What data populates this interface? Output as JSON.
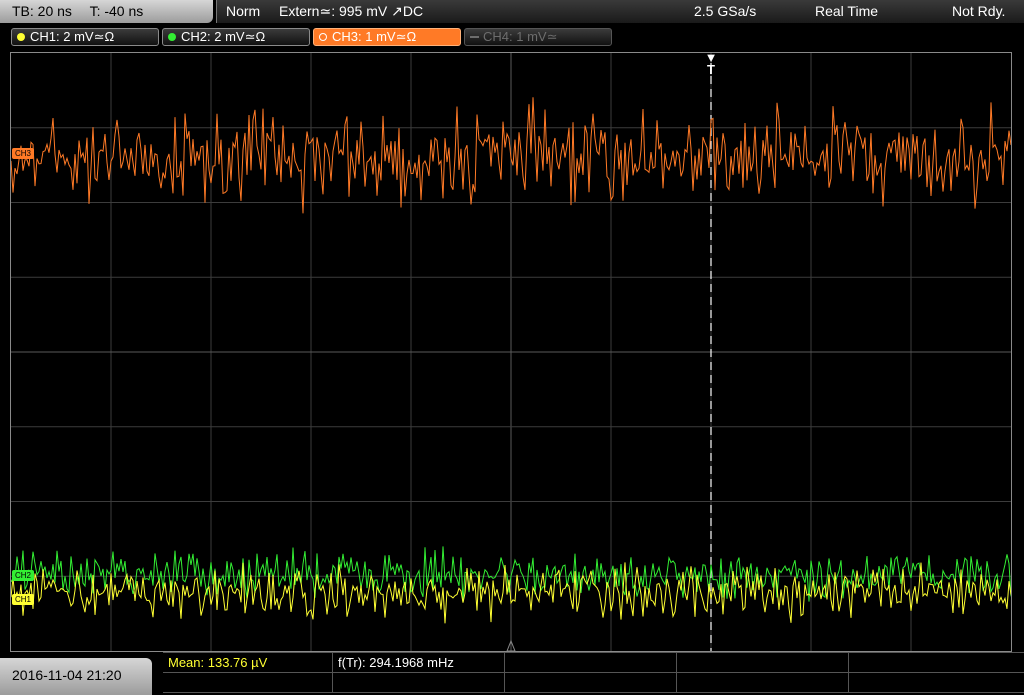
{
  "header": {
    "timebase": "TB: 20 ns",
    "trigger_time": "T: -40 ns",
    "acq_mode": "Norm",
    "trigger_source": "Extern≃: 995 mV ↗DC",
    "sample_rate": "2.5 GSa/s",
    "mode": "Real Time",
    "status": "Not Rdy."
  },
  "channels": [
    {
      "label": "CH1: 2 mV≃Ω",
      "color": "#ffff33",
      "active": true
    },
    {
      "label": "CH2: 2 mV≃Ω",
      "color": "#33ee33",
      "active": true
    },
    {
      "label": "CH3: 1 mV≃Ω",
      "color": "#ff7a26",
      "active": true,
      "selected": true
    },
    {
      "label": "CH4: 1 mV≃",
      "color": "#6d6d6d",
      "active": false
    }
  ],
  "markers": {
    "trigger": "T",
    "ch3": "CH3",
    "ch2": "CH2",
    "ch1": "CH1"
  },
  "trace_colors": {
    "ch1": "#ffff33",
    "ch2": "#33ee33",
    "ch3": "#ff7a26"
  },
  "measurements": {
    "mean": "Mean: 133.76 µV",
    "freq": "f(Tr): 294.1968 mHz"
  },
  "footer": {
    "datetime": "2016-11-04 21:20"
  }
}
